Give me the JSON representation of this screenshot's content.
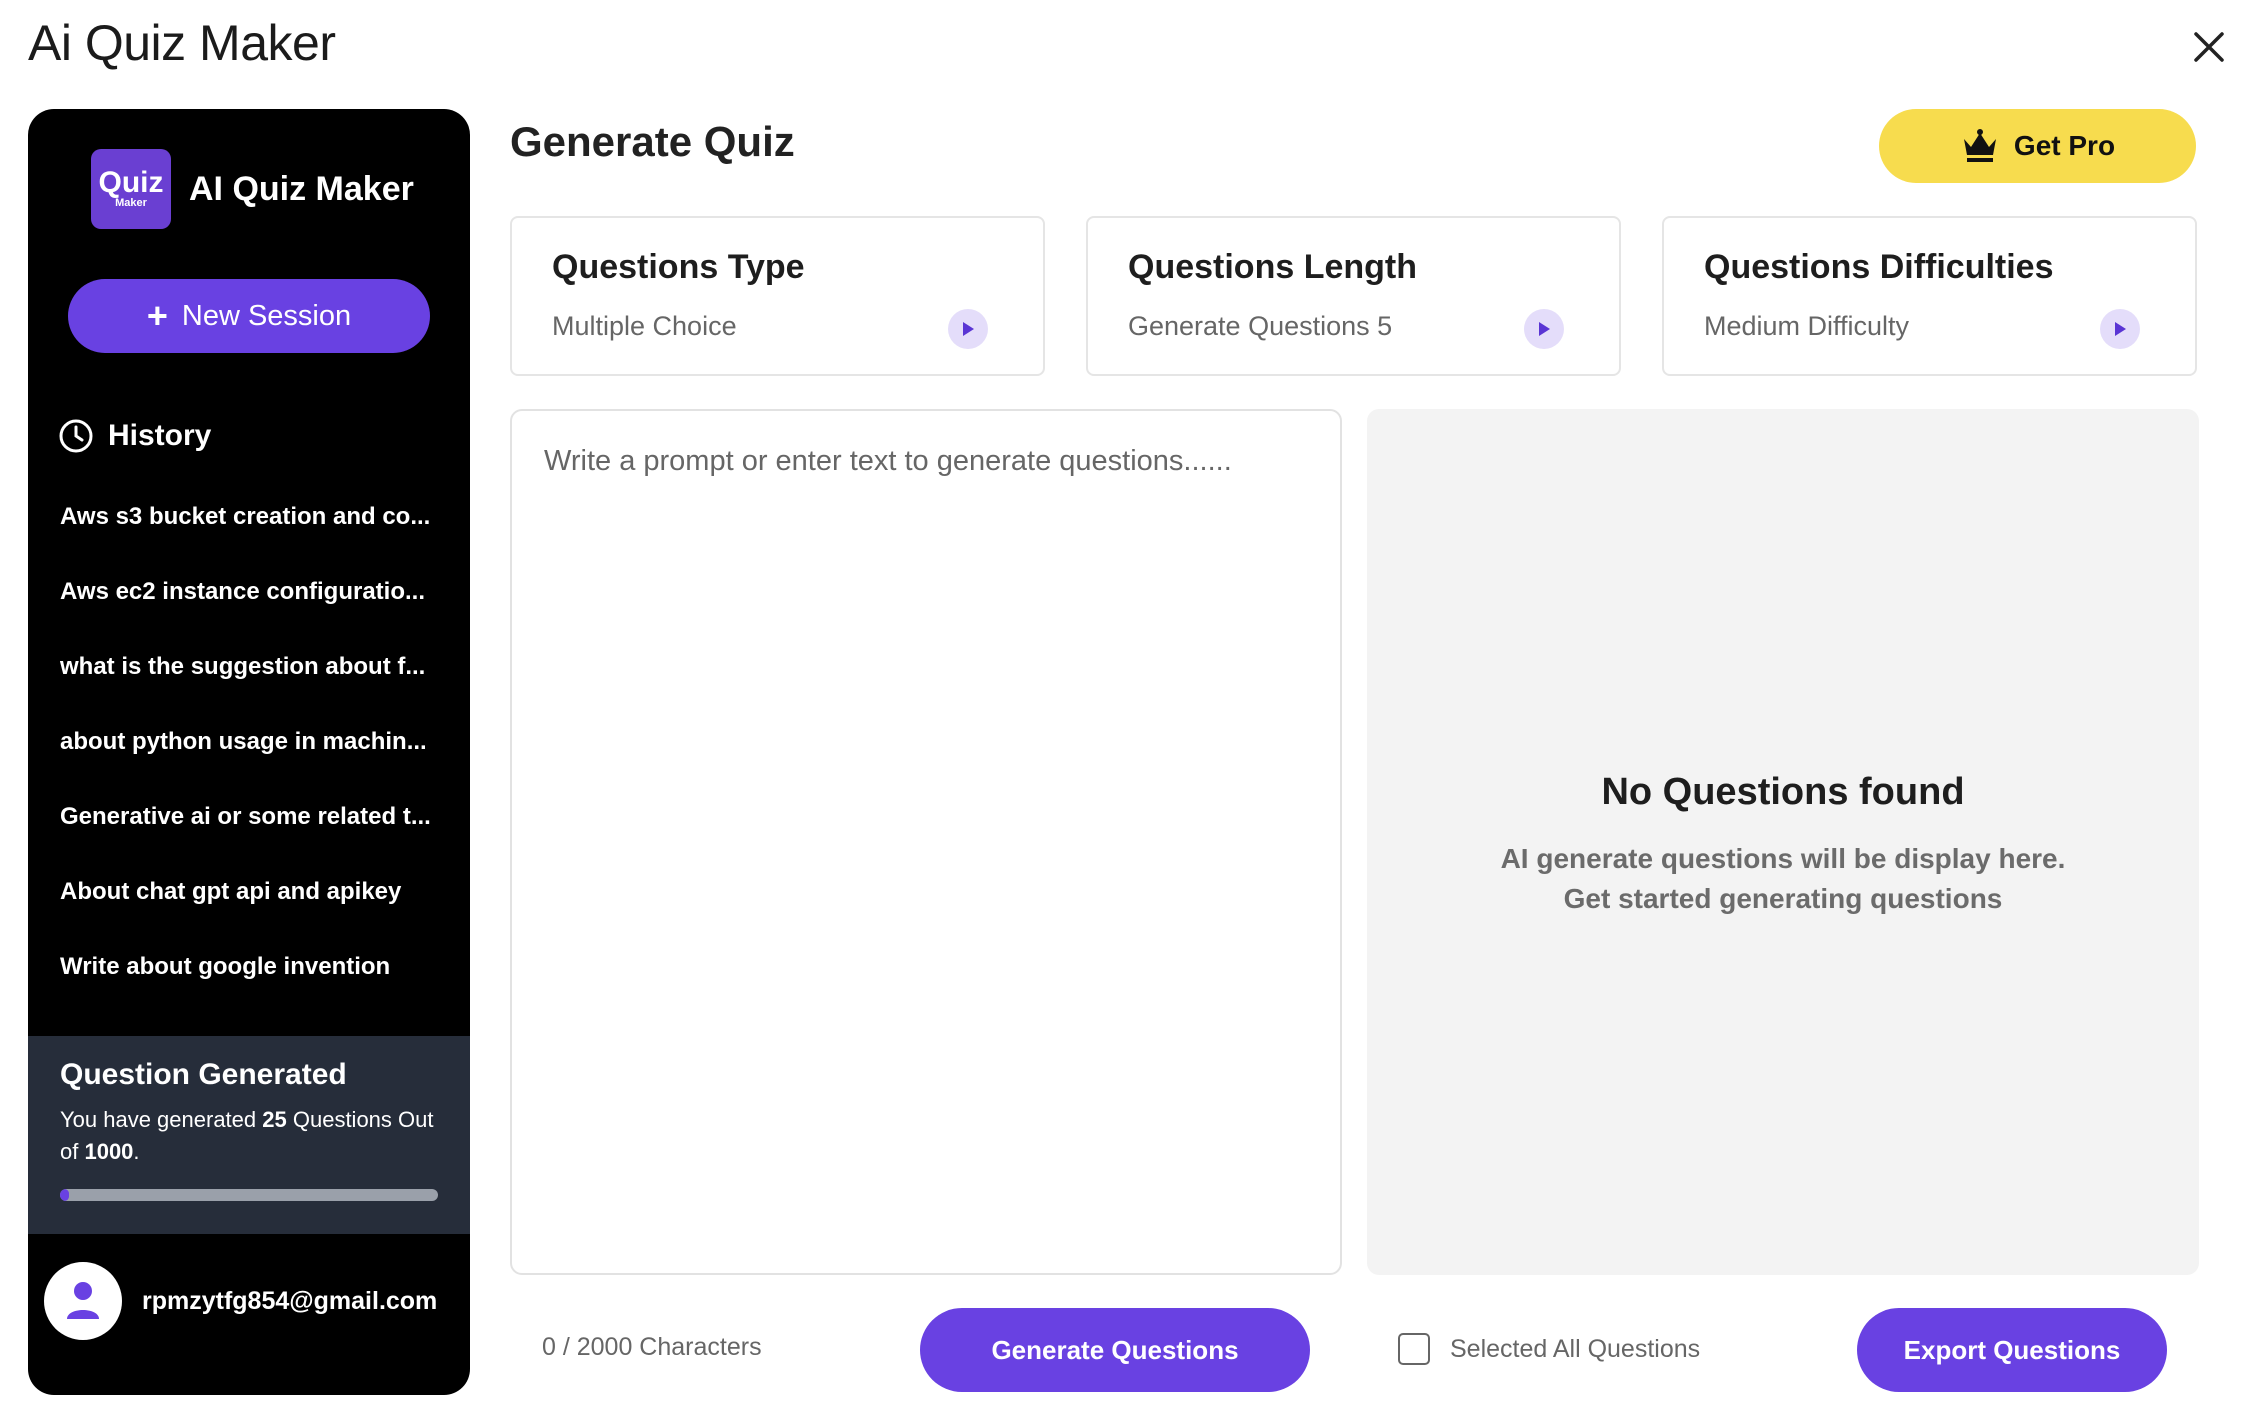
{
  "window": {
    "title": "Ai Quiz Maker",
    "close_icon": "close-icon"
  },
  "sidebar": {
    "brand": {
      "logo_line1": "Quiz",
      "logo_line2": "Maker",
      "name": "AI Quiz Maker",
      "logo_color": "#6a3fd2"
    },
    "new_session_label": "New Session",
    "history": {
      "label": "History",
      "items": [
        "Aws s3 bucket creation and co...",
        "Aws ec2 instance configuratio...",
        "what is the suggestion about f...",
        "about python usage in machin...",
        "Generative ai or some related t...",
        "About chat gpt api and apikey",
        "Write about google invention"
      ]
    },
    "stats": {
      "title": "Question Generated",
      "desc_prefix": "You have generated ",
      "generated": "25",
      "desc_middle": " Questions Out of ",
      "total": "1000",
      "desc_suffix": ".",
      "progress_fraction": 0.025
    },
    "user": {
      "email": "rpmzytfg854@gmail.com"
    }
  },
  "main": {
    "title": "Generate Quiz",
    "get_pro_label": "Get Pro",
    "cards": [
      {
        "title": "Questions Type",
        "value": "Multiple Choice"
      },
      {
        "title": "Questions Length",
        "value": "Generate Questions 5"
      },
      {
        "title": "Questions Difficulties",
        "value": "Medium Difficulty"
      }
    ],
    "prompt": {
      "placeholder": "Write a prompt or enter text to generate questions......",
      "value": ""
    },
    "result": {
      "empty_title": "No Questions found",
      "empty_line1": "AI generate questions will be display here.",
      "empty_line2": "Get started generating questions"
    },
    "char_count": "0 / 2000 Characters",
    "generate_label": "Generate Questions",
    "select_all_label": "Selected All Questions",
    "export_label": "Export Questions"
  },
  "colors": {
    "accent": "#6941e2",
    "pro": "#f7dc4e",
    "sidebar_bg": "#000000",
    "stats_bg": "#262d3a"
  }
}
